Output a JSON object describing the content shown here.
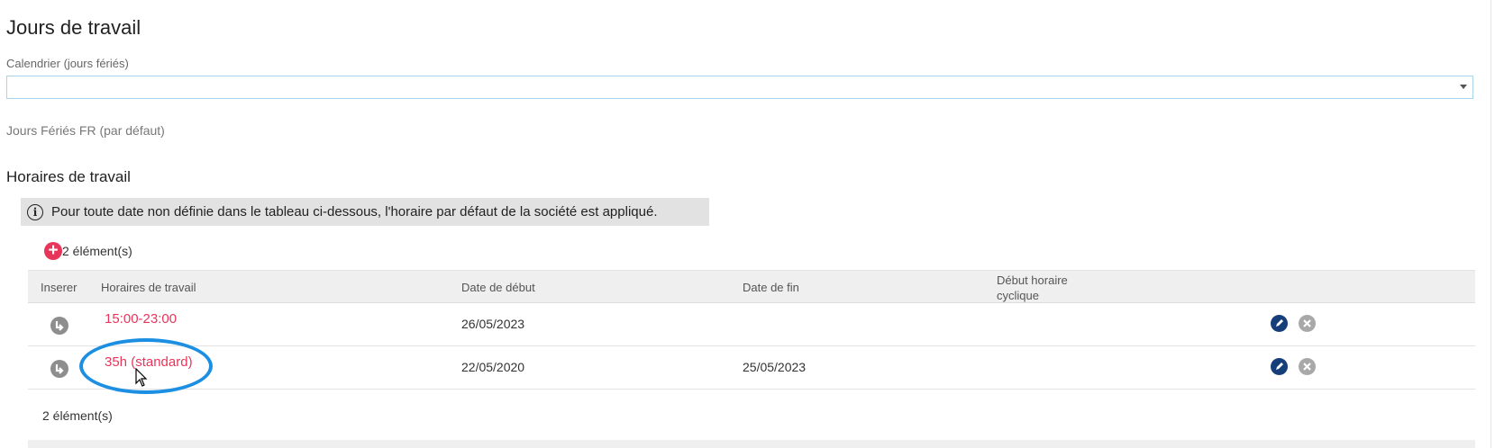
{
  "page": {
    "title": "Jours de travail"
  },
  "calendar": {
    "label": "Calendrier (jours fériés)",
    "value": "",
    "default_text": "Jours Fériés FR (par défaut)"
  },
  "schedules": {
    "title": "Horaires de travail",
    "info": "Pour toute date non définie dans le tableau ci-dessous, l'horaire par défaut de la société est appliqué.",
    "count_top": "2 élément(s)",
    "count_bottom": "2 élément(s)",
    "columns": {
      "insert": "Inserer",
      "schedule": "Horaires de travail",
      "start": "Date de début",
      "end": "Date de fin",
      "cyclic_line1": "Début horaire",
      "cyclic_line2": "cyclique"
    },
    "rows": [
      {
        "schedule": "15:00-23:00",
        "start": "26/05/2023",
        "end": ""
      },
      {
        "schedule": "35h (standard)",
        "start": "22/05/2020",
        "end": "25/05/2023"
      }
    ]
  },
  "colors": {
    "accent": "#e8355a",
    "highlight": "#1c8fe3",
    "edit_icon": "#163f7a"
  },
  "icons": {
    "info": "info-circle-icon",
    "add": "plus-circle-icon",
    "insert": "insert-arrow-icon",
    "edit": "edit-icon",
    "delete": "delete-x-icon"
  }
}
